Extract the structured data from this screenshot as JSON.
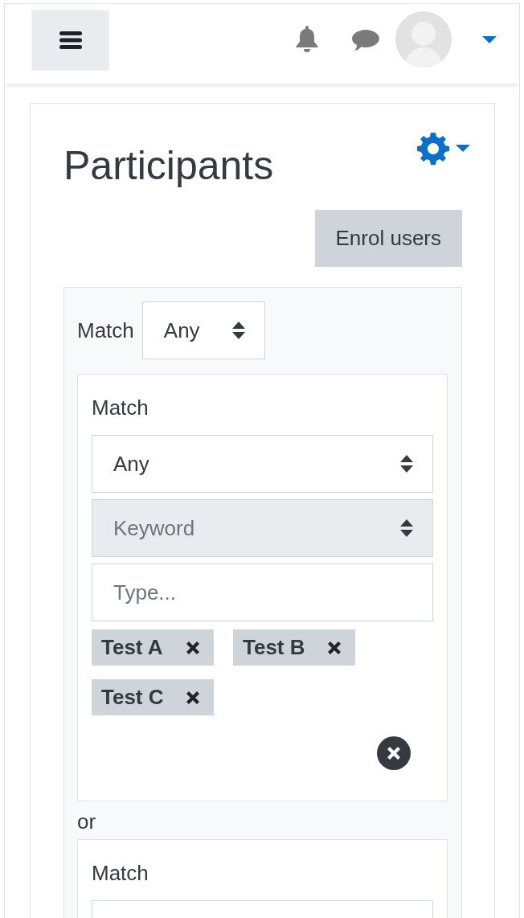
{
  "page": {
    "title": "Participants",
    "primary_button": "Enrol users"
  },
  "filters": {
    "match_label": "Match",
    "match_value": "Any",
    "rows": [
      {
        "match_label": "Match",
        "match_value": "Any",
        "field": {
          "value": "Keyword",
          "disabled": true
        },
        "input": {
          "placeholder": "Type..."
        },
        "tags": [
          "Test A",
          "Test B",
          "Test C"
        ]
      },
      {
        "match_label": "Match"
      }
    ],
    "joiner": "or"
  }
}
